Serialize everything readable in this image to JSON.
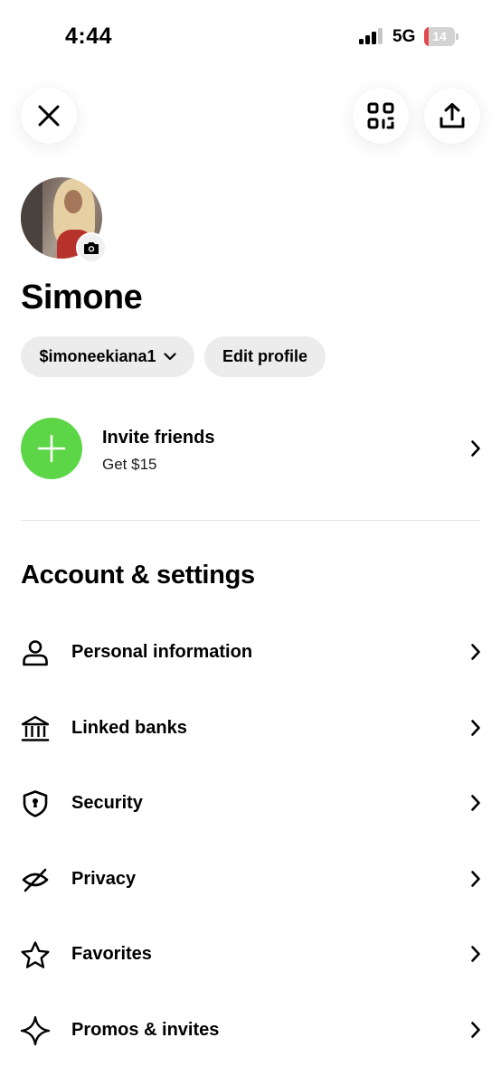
{
  "status_bar": {
    "time": "4:44",
    "network": "5G",
    "battery": "14",
    "signal_bars_active": 3,
    "signal_bars_total": 4,
    "battery_color": "#e5484d"
  },
  "header": {
    "close_icon": "close-icon",
    "qr_icon": "qr-scan-icon",
    "share_icon": "share-icon"
  },
  "profile": {
    "name": "Simone",
    "cashtag": "$imoneekiana1",
    "edit_label": "Edit profile",
    "camera_icon": "camera-icon"
  },
  "invite": {
    "title": "Invite friends",
    "subtitle": "Get $15",
    "accent": "#5cd547",
    "icon": "plus-icon"
  },
  "settings": {
    "title": "Account & settings",
    "items": [
      {
        "label": "Personal information",
        "icon": "person-icon"
      },
      {
        "label": "Linked banks",
        "icon": "bank-icon"
      },
      {
        "label": "Security",
        "icon": "shield-icon"
      },
      {
        "label": "Privacy",
        "icon": "eye-off-icon"
      },
      {
        "label": "Favorites",
        "icon": "star-icon"
      },
      {
        "label": "Promos & invites",
        "icon": "sparkle-icon"
      }
    ]
  }
}
